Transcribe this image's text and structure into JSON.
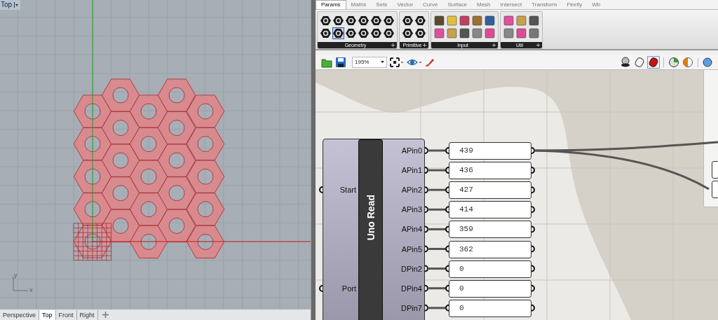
{
  "viewport": {
    "title": "Top",
    "axis_labels": [
      "y",
      "x"
    ],
    "tabs": [
      {
        "label": "Perspective",
        "selected": false
      },
      {
        "label": "Top",
        "selected": true
      },
      {
        "label": "Front",
        "selected": false
      },
      {
        "label": "Right",
        "selected": false
      }
    ]
  },
  "editor": {
    "tabs": [
      {
        "label": "Params",
        "selected": true
      },
      {
        "label": "Maths",
        "selected": false
      },
      {
        "label": "Sets",
        "selected": false
      },
      {
        "label": "Vector",
        "selected": false
      },
      {
        "label": "Curve",
        "selected": false
      },
      {
        "label": "Surface",
        "selected": false
      },
      {
        "label": "Mesh",
        "selected": false
      },
      {
        "label": "Intersect",
        "selected": false
      },
      {
        "label": "Transform",
        "selected": false
      },
      {
        "label": "Firefly",
        "selected": false
      },
      {
        "label": "Wb",
        "selected": false
      }
    ],
    "ribbon_groups": [
      {
        "label": "Geometry",
        "kind": "hex",
        "icons": [
          {
            "selected": false
          },
          {
            "selected": false
          },
          {
            "selected": false
          },
          {
            "selected": false
          },
          {
            "selected": false
          },
          {
            "selected": false
          },
          {
            "selected": false
          },
          {
            "selected": true
          },
          {
            "selected": false
          },
          {
            "selected": false
          },
          {
            "selected": false
          },
          {
            "selected": false
          }
        ]
      },
      {
        "label": "Primitive",
        "kind": "hex",
        "icons": [
          {
            "selected": false
          },
          {
            "selected": false
          },
          {
            "selected": false
          },
          {
            "selected": false
          }
        ]
      },
      {
        "label": "Input",
        "kind": "tile",
        "icons": [
          {
            "selected": false
          },
          {
            "selected": false
          },
          {
            "selected": false
          },
          {
            "selected": false
          },
          {
            "selected": false
          },
          {
            "selected": false
          },
          {
            "selected": false
          },
          {
            "selected": false
          },
          {
            "selected": false
          },
          {
            "selected": false
          }
        ]
      },
      {
        "label": "Util",
        "kind": "tile",
        "icons": [
          {
            "selected": false
          },
          {
            "selected": false
          },
          {
            "selected": false
          },
          {
            "selected": false
          },
          {
            "selected": false
          },
          {
            "selected": false
          }
        ]
      }
    ],
    "zoom": "195%",
    "preview_icons": [
      {
        "selected": false
      },
      {
        "selected": false
      },
      {
        "selected": true
      }
    ],
    "component": {
      "title": "Uno Read",
      "inputs": [
        "Start",
        "Port"
      ],
      "outputs": [
        "APin0",
        "APin1",
        "APin2",
        "APin3",
        "APin4",
        "APin5",
        "DPin2",
        "DPin4",
        "DPin7"
      ]
    },
    "panels": [
      "439",
      "436",
      "427",
      "414",
      "359",
      "362",
      "0",
      "0",
      "0"
    ]
  }
}
